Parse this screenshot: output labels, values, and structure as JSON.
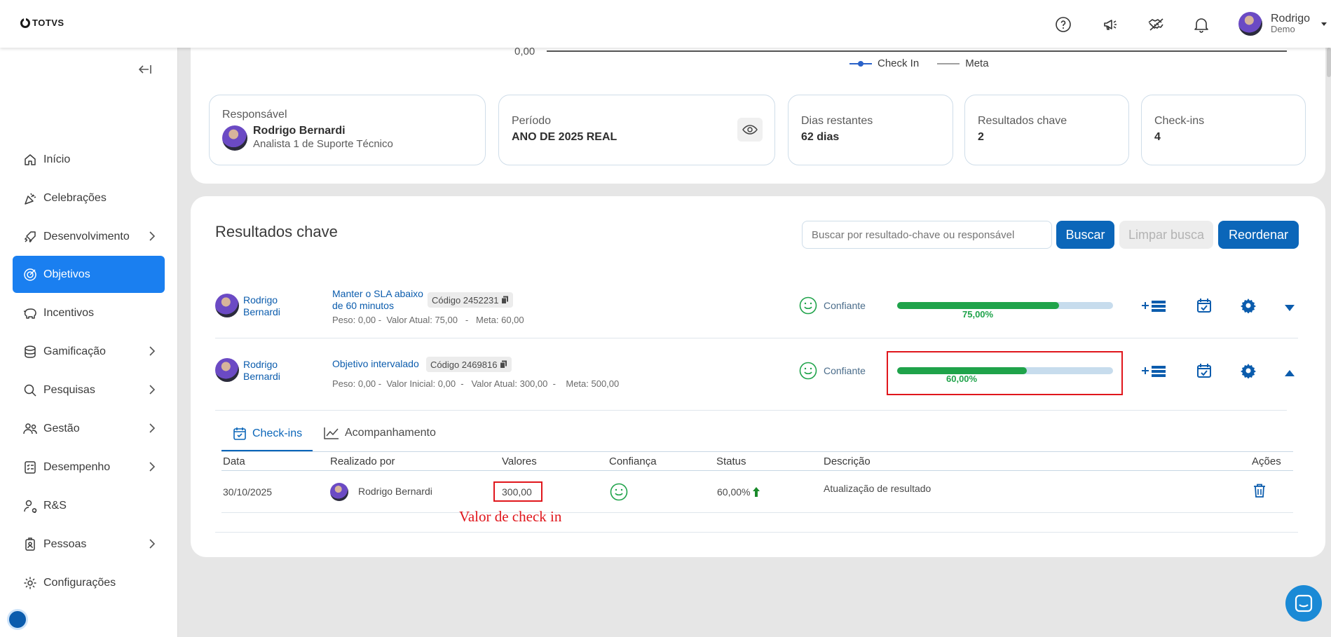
{
  "app": {
    "logo_text": "TOTVS"
  },
  "header": {
    "icons": [
      "help-icon",
      "megaphone-icon",
      "handshake-icon",
      "bell-icon"
    ],
    "user": {
      "name": "Rodrigo",
      "subtitle": "Demo"
    }
  },
  "sidebar": {
    "items": [
      {
        "label": "Início",
        "icon": "home-icon",
        "has_children": false,
        "active": false
      },
      {
        "label": "Celebrações",
        "icon": "party-icon",
        "has_children": false,
        "active": false
      },
      {
        "label": "Desenvolvimento",
        "icon": "rocket-icon",
        "has_children": true,
        "active": false
      },
      {
        "label": "Objetivos",
        "icon": "target-icon",
        "has_children": false,
        "active": true
      },
      {
        "label": "Incentivos",
        "icon": "piggy-bank-icon",
        "has_children": false,
        "active": false
      },
      {
        "label": "Gamificação",
        "icon": "coins-icon",
        "has_children": true,
        "active": false
      },
      {
        "label": "Pesquisas",
        "icon": "search-icon",
        "has_children": true,
        "active": false
      },
      {
        "label": "Gestão",
        "icon": "people-icon",
        "has_children": true,
        "active": false
      },
      {
        "label": "Desempenho",
        "icon": "checklist-icon",
        "has_children": true,
        "active": false
      },
      {
        "label": "R&S",
        "icon": "user-search-icon",
        "has_children": false,
        "active": false
      },
      {
        "label": "Pessoas",
        "icon": "badge-icon",
        "has_children": true,
        "active": false
      },
      {
        "label": "Configurações",
        "icon": "gear-icon",
        "has_children": false,
        "active": false
      }
    ]
  },
  "chart": {
    "axis_zero_label": "0,00",
    "legend": [
      {
        "name": "Check In",
        "color": "#2a62c9"
      },
      {
        "name": "Meta",
        "color": "#a0a0a0"
      }
    ]
  },
  "summary": {
    "responsavel": {
      "label": "Responsável",
      "name": "Rodrigo Bernardi",
      "role": "Analista 1 de Suporte Técnico"
    },
    "periodo": {
      "label": "Período",
      "value": "ANO DE 2025 REAL"
    },
    "dias_restantes": {
      "label": "Dias restantes",
      "value": "62 dias"
    },
    "resultados_chave": {
      "label": "Resultados chave",
      "value": "2"
    },
    "checkins": {
      "label": "Check-ins",
      "value": "4"
    }
  },
  "key_results": {
    "title": "Resultados chave",
    "search_placeholder": "Buscar por resultado-chave ou responsável",
    "buttons": {
      "search": "Buscar",
      "clear": "Limpar busca",
      "reorder": "Reordenar"
    },
    "rows": [
      {
        "owner_first": "Rodrigo",
        "owner_last": "Bernardi",
        "title_line1": "Manter o SLA abaixo",
        "title_line2": "de 60 minutos",
        "code": "Código 2452231",
        "meta": "Peso: 0,00 -  Valor Atual: 75,00   -   Meta: 60,00",
        "confidence": "Confiante",
        "progress": 0.75,
        "progress_label": "75,00%"
      },
      {
        "owner_first": "Rodrigo",
        "owner_last": "Bernardi",
        "title_line1": "Objetivo intervalado",
        "title_line2": "",
        "code": "Código 2469816",
        "meta": "Peso: 0,00 -  Valor Inicial: 0,00  -   Valor Atual: 300,00  -    Meta: 500,00",
        "confidence": "Confiante",
        "progress": 0.6,
        "progress_label": "60,00%"
      }
    ]
  },
  "details": {
    "tabs": [
      {
        "label": "Check-ins",
        "icon": "calendar-check-icon",
        "active": true
      },
      {
        "label": "Acompanhamento",
        "icon": "line-chart-icon",
        "active": false
      }
    ],
    "columns": [
      "Data",
      "Realizado por",
      "Valores",
      "Confiança",
      "Status",
      "Descrição",
      "Ações"
    ],
    "rows": [
      {
        "date": "30/10/2025",
        "by": "Rodrigo Bernardi",
        "value": "300,00",
        "confidence_icon": "smiley-icon",
        "status": "60,00%",
        "status_icon": "arrow-up-icon",
        "description": "Atualização de resultado",
        "action_icon": "trash-icon"
      }
    ],
    "annotation": "Valor de check in"
  },
  "colors": {
    "primary": "#0b66b9",
    "active_nav": "#1a7ff0",
    "progress_green": "#1fa34a",
    "progress_track": "#c7dced",
    "highlight_red": "#e0161c"
  }
}
